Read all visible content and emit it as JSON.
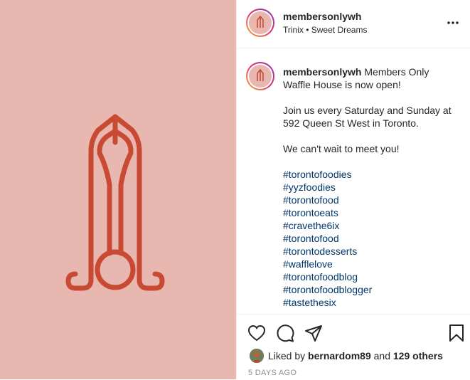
{
  "post": {
    "username": "membersonlywh",
    "location": "Trinix • Sweet Dreams",
    "caption_lead": "Members Only Waffle House is now open!",
    "caption_p2": "Join us every Saturday and Sunday at 592 Queen St West in Toronto.",
    "caption_p3": "We can't wait to meet you!",
    "hashtags": [
      "#torontofoodies",
      "#yyzfoodies",
      "#torontofood",
      "#torontoeats",
      "#cravethe6ix",
      "#torontofood",
      "#torontodesserts",
      "#wafflelove",
      "#torontofoodblog",
      "#torontofoodblogger",
      "#tastethesix"
    ],
    "likes_prefix": "Liked by",
    "liked_by_user": "bernardom89",
    "likes_and": "and",
    "likes_others": "129 others",
    "timestamp": "5 DAYS AGO"
  },
  "colors": {
    "image_background": "#e7b7b0",
    "logo": "#c94a33",
    "hashtag": "#00376b",
    "muted": "#8e8e8e"
  },
  "icons": [
    "more-options-icon",
    "heart-icon",
    "comment-icon",
    "share-icon",
    "bookmark-icon"
  ]
}
